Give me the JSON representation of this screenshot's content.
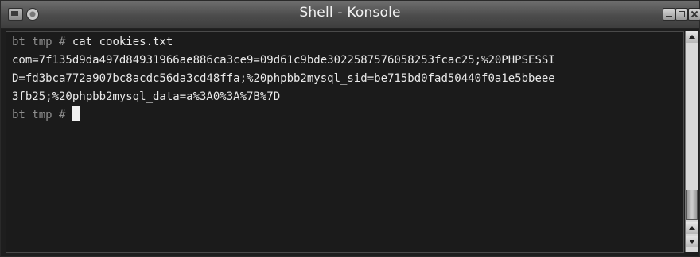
{
  "window": {
    "title": "Shell - Konsole"
  },
  "terminal": {
    "lines": [
      {
        "prompt": "bt tmp #",
        "command": " cat cookies.txt"
      },
      {
        "text": "com=7f135d9da497d84931966ae886ca3ce9=09d61c9bde3022587576058253fcac25;%20PHPSESSI"
      },
      {
        "text": "D=fd3bca772a907bc8acdc56da3cd48ffa;%20phpbb2mysql_sid=be715bd0fad50440f0a1e5bbeee"
      },
      {
        "text": "3fb25;%20phpbb2mysql_data=a%3A0%3A%7B%7D"
      },
      {
        "prompt": "bt tmp #",
        "command": " "
      }
    ]
  },
  "icons": {
    "app": "konsole-icon",
    "sticky": "pin-icon",
    "minimize": "minimize-icon",
    "maximize": "maximize-icon",
    "close": "close-icon"
  }
}
